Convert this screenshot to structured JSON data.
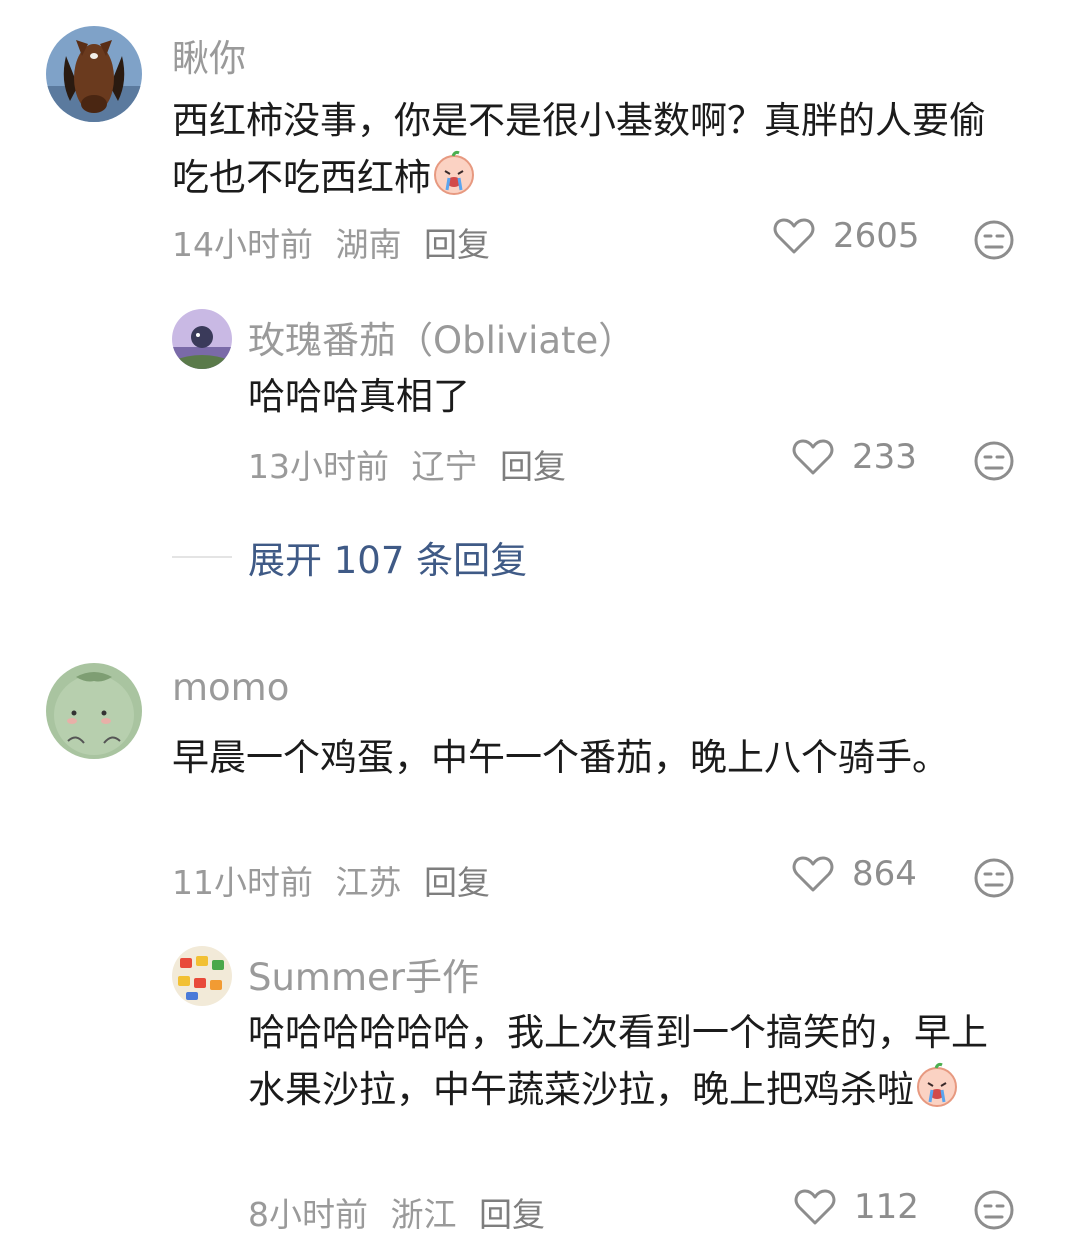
{
  "comments": [
    {
      "username": "瞅你",
      "content": "西红柿没事，你是不是很小基数啊？真胖的人要偷吃也不吃西红柿",
      "time": "14小时前",
      "location": "湖南",
      "reply_label": "回复",
      "likes": "2605",
      "emoji": "crying-laugh-emoji"
    },
    {
      "username": "玫瑰番茄（Obliviate）",
      "content": "哈哈哈真相了",
      "time": "13小时前",
      "location": "辽宁",
      "reply_label": "回复",
      "likes": "233"
    },
    {
      "username": "momo",
      "content": "早晨一个鸡蛋，中午一个番茄，晚上八个骑手。",
      "time": "11小时前",
      "location": "江苏",
      "reply_label": "回复",
      "likes": "864"
    },
    {
      "username": "Summer手作",
      "content": "哈哈哈哈哈哈，我上次看到一个搞笑的，早上水果沙拉，中午蔬菜沙拉，晚上把鸡杀啦",
      "time": "8小时前",
      "location": "浙江",
      "reply_label": "回复",
      "likes": "112",
      "emoji": "crying-laugh-emoji"
    }
  ],
  "expand_replies": {
    "label": "展开 107 条回复"
  },
  "icons": {
    "like": "heart-outline-icon",
    "dislike": "meh-face-icon"
  },
  "colors": {
    "text": "#1b1b1b",
    "muted": "#9a9a9a",
    "link": "#3f5a86"
  }
}
